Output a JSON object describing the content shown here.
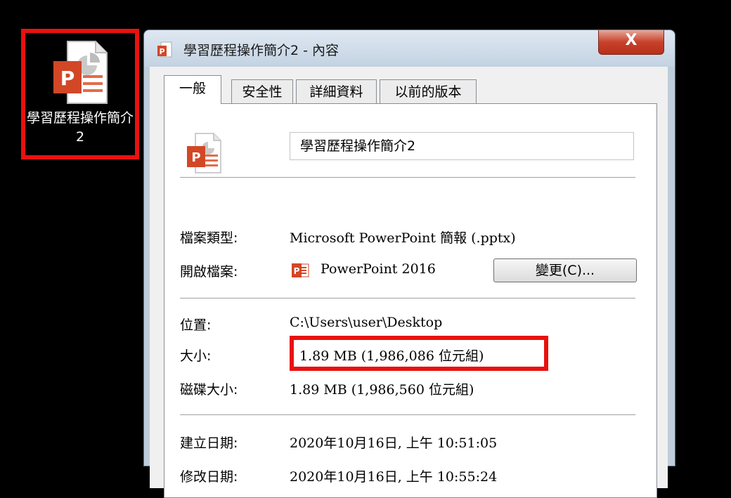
{
  "desktop": {
    "icon": {
      "name": "powerpoint-file-icon",
      "label": "學習歷程操作簡介2"
    }
  },
  "window": {
    "title": "學習歷程操作簡介2 - 內容",
    "close_label": "X",
    "tabs": [
      {
        "label": "一般",
        "active": true
      },
      {
        "label": "安全性",
        "active": false
      },
      {
        "label": "詳細資料",
        "active": false
      },
      {
        "label": "以前的版本",
        "active": false
      }
    ],
    "general": {
      "file_name": "學習歷程操作簡介2",
      "file_type_label": "檔案類型:",
      "file_type_value": "Microsoft PowerPoint 簡報 (.pptx)",
      "opens_with_label": "開啟檔案:",
      "opens_with_value": "PowerPoint 2016",
      "change_button": "變更(C)...",
      "location_label": "位置:",
      "location_value": "C:\\Users\\user\\Desktop",
      "size_label": "大小:",
      "size_value": "1.89 MB (1,986,086 位元組)",
      "size_on_disk_label": "磁碟大小:",
      "size_on_disk_value": "1.89 MB (1,986,560 位元組)",
      "created_label": "建立日期:",
      "created_value": "2020年10月16日, 上午 10:51:05",
      "modified_label": "修改日期:",
      "modified_value": "2020年10月16日, 上午 10:55:24"
    }
  },
  "colors": {
    "highlight": "#e8120f",
    "powerpoint": "#d24726"
  }
}
